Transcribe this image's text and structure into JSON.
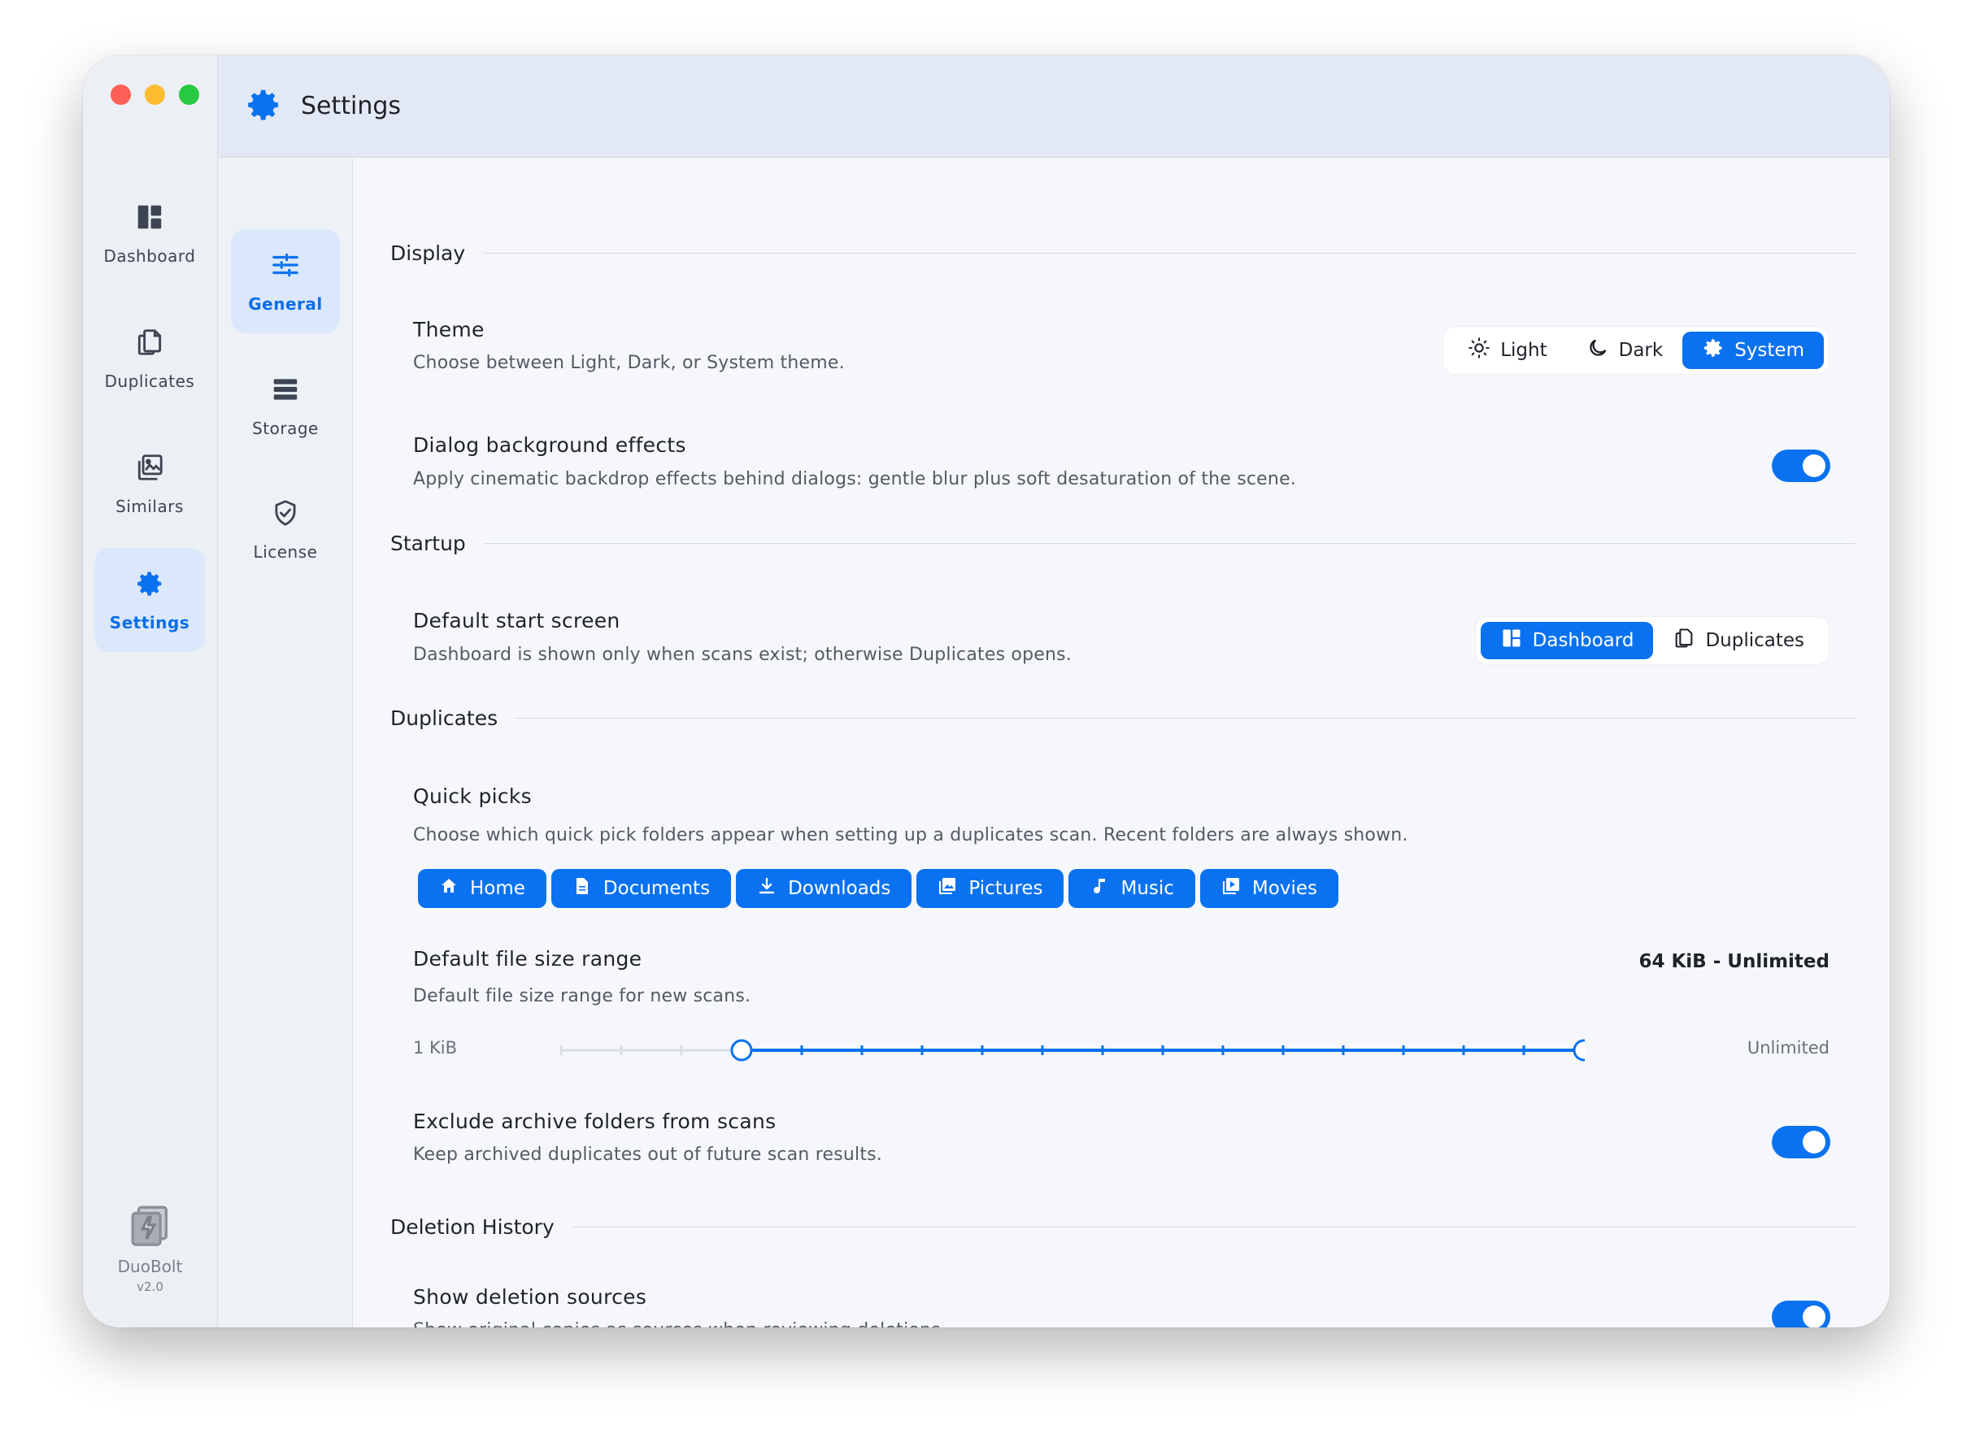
{
  "window": {
    "title": "Settings"
  },
  "rail": {
    "items": [
      {
        "label": "Dashboard",
        "icon": "dashboard-icon",
        "active": false
      },
      {
        "label": "Duplicates",
        "icon": "duplicates-icon",
        "active": false
      },
      {
        "label": "Similars",
        "icon": "similars-icon",
        "active": false
      },
      {
        "label": "Settings",
        "icon": "gear-icon",
        "active": true
      }
    ],
    "brand": {
      "name": "DuoBolt",
      "version": "v2.0"
    }
  },
  "subnav": {
    "items": [
      {
        "label": "General",
        "icon": "sliders-icon",
        "active": true
      },
      {
        "label": "Storage",
        "icon": "storage-icon",
        "active": false
      },
      {
        "label": "License",
        "icon": "shield-check-icon",
        "active": false
      }
    ]
  },
  "sections": {
    "display": {
      "title": "Display",
      "theme": {
        "title": "Theme",
        "desc": "Choose between Light, Dark, or System theme.",
        "options": [
          "Light",
          "Dark",
          "System"
        ],
        "selected": "System"
      },
      "dialog_effects": {
        "title": "Dialog background effects",
        "desc": "Apply cinematic backdrop effects behind dialogs: gentle blur plus soft desaturation of the scene.",
        "enabled": true
      }
    },
    "startup": {
      "title": "Startup",
      "start_screen": {
        "title": "Default start screen",
        "desc": "Dashboard is shown only when scans exist; otherwise Duplicates opens.",
        "options": [
          "Dashboard",
          "Duplicates"
        ],
        "selected": "Dashboard"
      }
    },
    "duplicates": {
      "title": "Duplicates",
      "quick_picks": {
        "title": "Quick picks",
        "desc": "Choose which quick pick folders appear when setting up a duplicates scan. Recent folders are always shown.",
        "chips": [
          "Home",
          "Documents",
          "Downloads",
          "Pictures",
          "Music",
          "Movies"
        ]
      },
      "size_range": {
        "title": "Default file size range",
        "desc": "Default file size range for new scans.",
        "value": "64 KiB - Unlimited",
        "min_label": "1 KiB",
        "max_label": "Unlimited",
        "steps": 18,
        "low_index": 3,
        "high_index": 17
      },
      "exclude_archive": {
        "title": "Exclude archive folders from scans",
        "desc": "Keep archived duplicates out of future scan results.",
        "enabled": true
      }
    },
    "deletion_history": {
      "title": "Deletion History",
      "show_sources": {
        "title": "Show deletion sources",
        "desc": "Show original copies as sources when reviewing deletions.",
        "enabled": true
      }
    }
  },
  "colors": {
    "accent": "#0a72f0",
    "track": "#d9dde4"
  }
}
